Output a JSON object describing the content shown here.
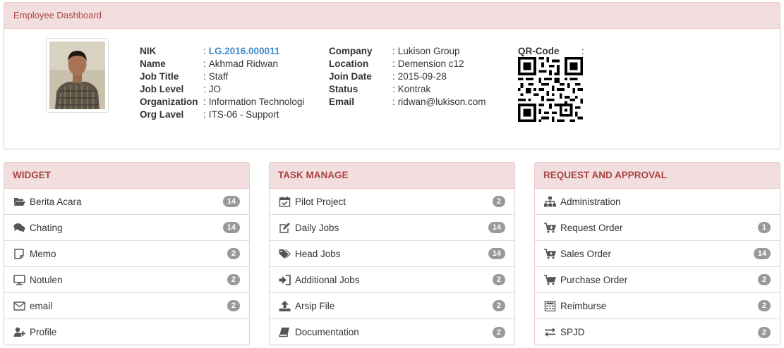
{
  "dashboard": {
    "title": "Employee Dashboard",
    "left_fields": [
      {
        "label": "NIK",
        "value": "LG.2016.000011"
      },
      {
        "label": "Name",
        "value": "Akhmad Ridwan"
      },
      {
        "label": "Job Title",
        "value": "Staff"
      },
      {
        "label": "Job Level",
        "value": "JO"
      },
      {
        "label": "Organization",
        "value": "Information Technologi"
      },
      {
        "label": "Org Lavel",
        "value": "ITS-06 - Support"
      }
    ],
    "right_fields": [
      {
        "label": "Company",
        "value": "Lukison Group"
      },
      {
        "label": "Location",
        "value": "Demension c12"
      },
      {
        "label": "Join Date",
        "value": "2015-09-28"
      },
      {
        "label": "Status",
        "value": "Kontrak"
      },
      {
        "label": "Email",
        "value": "ridwan@lukison.com"
      }
    ],
    "qr_label": "QR-Code",
    "separator": ":"
  },
  "widget": {
    "title": "WIDGET",
    "items": [
      {
        "label": "Berita Acara",
        "badge": "14",
        "icon": "folder-open-icon"
      },
      {
        "label": "Chating",
        "badge": "14",
        "icon": "comments-icon"
      },
      {
        "label": "Memo",
        "badge": "2",
        "icon": "sticky-note-icon"
      },
      {
        "label": "Notulen",
        "badge": "2",
        "icon": "desktop-icon"
      },
      {
        "label": "email",
        "badge": "2",
        "icon": "envelope-icon"
      },
      {
        "label": "Profile",
        "badge": "",
        "icon": "user-plus-icon"
      }
    ]
  },
  "task": {
    "title": "TASK MANAGE",
    "items": [
      {
        "label": "Pilot Project",
        "badge": "2",
        "icon": "calendar-check-icon"
      },
      {
        "label": "Daily Jobs",
        "badge": "14",
        "icon": "edit-icon"
      },
      {
        "label": "Head Jobs",
        "badge": "14",
        "icon": "tags-icon"
      },
      {
        "label": "Additional Jobs",
        "badge": "2",
        "icon": "sign-in-icon"
      },
      {
        "label": "Arsip File",
        "badge": "2",
        "icon": "upload-icon"
      },
      {
        "label": "Documentation",
        "badge": "2",
        "icon": "book-icon"
      }
    ]
  },
  "request": {
    "title": "REQUEST AND APPROVAL",
    "items": [
      {
        "label": "Administration",
        "badge": "",
        "icon": "sitemap-icon"
      },
      {
        "label": "Request Order",
        "badge": "1",
        "icon": "cart-plus-icon"
      },
      {
        "label": "Sales Order",
        "badge": "14",
        "icon": "cart-arrow-icon"
      },
      {
        "label": "Purchase Order",
        "badge": "2",
        "icon": "shopping-cart-icon"
      },
      {
        "label": "Reimburse",
        "badge": "2",
        "icon": "calculator-icon"
      },
      {
        "label": "SPJD",
        "badge": "2",
        "icon": "exchange-icon"
      }
    ]
  },
  "colors": {
    "heading_bg": "#f2dede",
    "heading_text": "#a94442",
    "link": "#428bca",
    "badge": "#999999"
  }
}
